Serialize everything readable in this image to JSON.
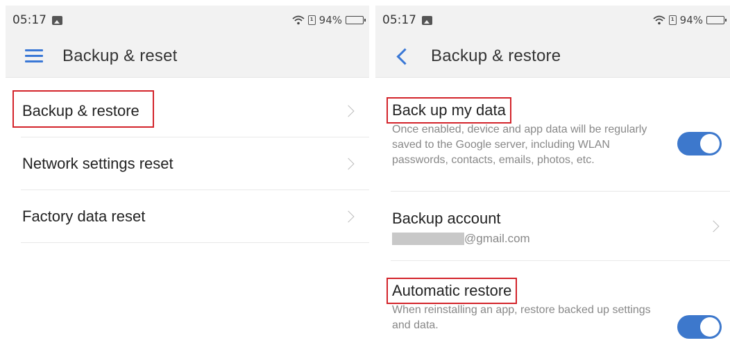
{
  "left": {
    "status": {
      "time": "05:17",
      "battery_text": "94%",
      "battery_level": 0.94
    },
    "appbar": {
      "title": "Backup & reset"
    },
    "menu_items": [
      {
        "label": "Backup & restore",
        "highlighted": true
      },
      {
        "label": "Network settings reset"
      },
      {
        "label": "Factory data reset"
      }
    ]
  },
  "right": {
    "status": {
      "time": "05:17",
      "battery_text": "94%",
      "battery_level": 0.94
    },
    "appbar": {
      "title": "Backup & restore"
    },
    "settings": {
      "backup_data": {
        "title": "Back up my data",
        "description": "Once enabled, device and app data will be regularly saved to the Google server, including WLAN passwords, contacts, emails, photos, etc.",
        "enabled": true
      },
      "backup_account": {
        "title": "Backup account",
        "email_suffix": "@gmail.com"
      },
      "auto_restore": {
        "title": "Automatic restore",
        "description": "When reinstalling an app, restore backed up settings and data.",
        "enabled": true
      }
    }
  },
  "colors": {
    "accent": "#3a78d6",
    "highlight": "#d3232a",
    "toggle_on": "#3d78cc"
  }
}
